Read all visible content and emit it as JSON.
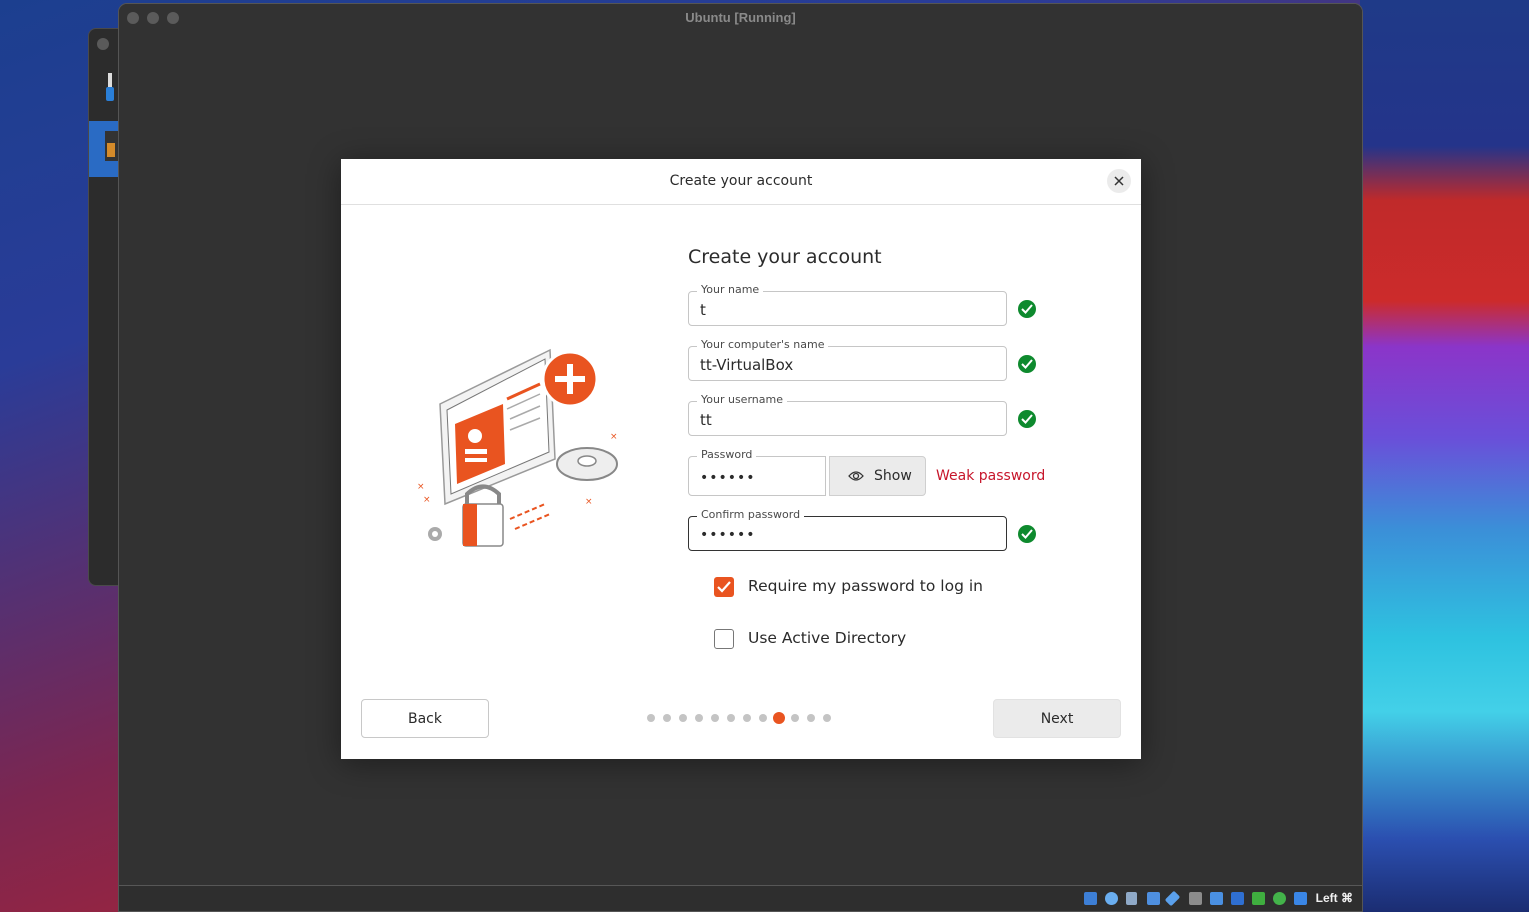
{
  "window": {
    "title": "Ubuntu [Running]"
  },
  "dialog": {
    "title": "Create your account",
    "heading": "Create your account",
    "fields": {
      "name": {
        "label": "Your name",
        "value": "t"
      },
      "computer": {
        "label": "Your computer's name",
        "value": "tt-VirtualBox"
      },
      "username": {
        "label": "Your username",
        "value": "tt"
      },
      "password": {
        "label": "Password",
        "value": "••••••",
        "show_label": "Show",
        "strength": "Weak password"
      },
      "confirm": {
        "label": "Confirm password",
        "value": "••••••"
      }
    },
    "options": {
      "require_password": {
        "label": "Require my password to log in",
        "checked": true
      },
      "active_directory": {
        "label": "Use Active Directory",
        "checked": false
      }
    },
    "buttons": {
      "back": "Back",
      "next": "Next"
    },
    "steps": {
      "total": 12,
      "current": 9
    }
  },
  "status_bar": {
    "host_key": "Left ⌘",
    "icons": [
      "hard-disk-icon",
      "optical-drive-icon",
      "audio-icon",
      "network-icon",
      "usb-icon",
      "shared-folders-icon",
      "display-icon",
      "video-capture-icon",
      "recording-icon",
      "mouse-integration-icon",
      "cpu-icon",
      "keyboard-icon"
    ]
  },
  "colors": {
    "accent": "#e95420",
    "valid": "#0e8a2e",
    "warning": "#c7162b"
  }
}
